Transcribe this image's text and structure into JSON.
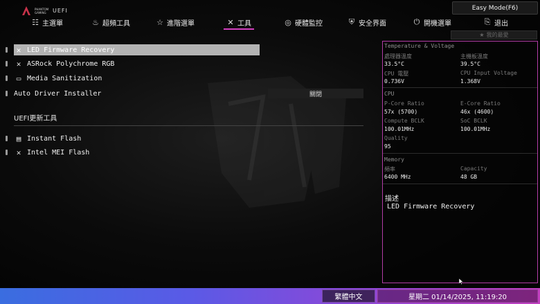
{
  "header": {
    "logo_text": "PHANTOM GAMING",
    "uefi_label": "UEFI",
    "easy_mode_label": "Easy Mode(F6)",
    "favorites_label": "我的最愛"
  },
  "nav": {
    "items": [
      {
        "label": "主選單",
        "icon": "grid-icon"
      },
      {
        "label": "超頻工具",
        "icon": "flame-icon"
      },
      {
        "label": "進階選單",
        "icon": "star-icon"
      },
      {
        "label": "工具",
        "icon": "tools-icon",
        "active": true
      },
      {
        "label": "硬體監控",
        "icon": "monitor-icon"
      },
      {
        "label": "安全界面",
        "icon": "shield-icon"
      },
      {
        "label": "開機選單",
        "icon": "power-icon"
      },
      {
        "label": "退出",
        "icon": "exit-icon"
      }
    ]
  },
  "menu": {
    "items": [
      {
        "label": "LED Firmware Recovery",
        "icon": "tools-icon",
        "selected": true
      },
      {
        "label": "ASRock Polychrome RGB",
        "icon": "tools-icon"
      },
      {
        "label": "Media Sanitization",
        "icon": "folder-icon"
      },
      {
        "label": "Auto Driver Installer",
        "value": "關閉"
      }
    ],
    "section_title": "UEFI更新工具",
    "update_items": [
      {
        "label": "Instant Flash",
        "icon": "rom-icon"
      },
      {
        "label": "Intel MEI Flash",
        "icon": "tools-icon"
      }
    ]
  },
  "panel": {
    "tv_title": "Temperature & Voltage",
    "cpu_temp_label": "處理器溫度",
    "cpu_temp": "33.5°C",
    "mb_temp_label": "主機板溫度",
    "mb_temp": "39.5°C",
    "cpu_volt_label": "CPU 電壓",
    "cpu_volt": "0.736V",
    "cpu_input_label": "CPU Input Voltage",
    "cpu_input": "1.368V",
    "cpu_title": "CPU",
    "pcore_label": "P-Core Ratio",
    "pcore": "57x (5700)",
    "ecore_label": "E-Core Ratio",
    "ecore": "46x (4600)",
    "compute_label": "Compute BCLK",
    "compute": "100.01MHz",
    "soc_label": "SoC BCLK",
    "soc": "100.01MHz",
    "quality_label": "Quality",
    "quality": "95",
    "mem_title": "Memory",
    "freq_label": "頻率",
    "freq": "6400 MHz",
    "cap_label": "Capacity",
    "cap": "48 GB",
    "desc_title": "描述",
    "desc": "LED Firmware Recovery"
  },
  "footer": {
    "language": "繁體中文",
    "datetime": "星期二 01/14/2025, 11:19:20"
  },
  "colors": {
    "accent": "#d43fc0",
    "panel_border": "#b23ca6",
    "selected_bar": "#b3b3b3"
  }
}
